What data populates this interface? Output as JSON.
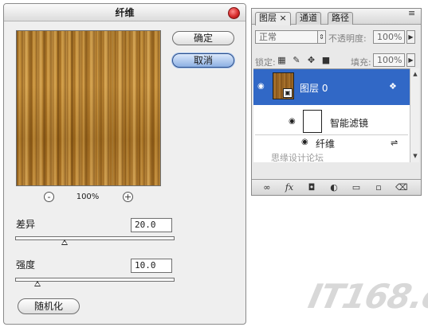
{
  "dialog": {
    "title": "纤维",
    "ok_label": "确定",
    "cancel_label": "取消",
    "zoom_minus": "-",
    "zoom_plus": "+",
    "zoom_level": "100%",
    "variance_label": "差异",
    "variance_value": "20.0",
    "variance_fraction": 0.31,
    "strength_label": "强度",
    "strength_value": "10.0",
    "strength_fraction": 0.14,
    "randomize_label": "随机化"
  },
  "layers_panel": {
    "tabs": [
      {
        "label": "图层 ×",
        "active": true
      },
      {
        "label": "通道",
        "active": false
      },
      {
        "label": "路径",
        "active": false
      }
    ],
    "menu_icon": "≡",
    "blend_mode": "正常",
    "opacity_label": "不透明度:",
    "opacity_value": "100%",
    "lock_label": "锁定:",
    "fill_label": "填充:",
    "fill_value": "100%",
    "layer_name": "图层 0",
    "smart_filters_label": "智能滤镜",
    "filter_name": "纤维",
    "watermark": "思缘设计论坛  www.MISSYUAN.COM"
  },
  "logo": "IT168.com",
  "colors": {
    "selection": "#3168c6",
    "cancel_focus": "#8db0e3"
  }
}
